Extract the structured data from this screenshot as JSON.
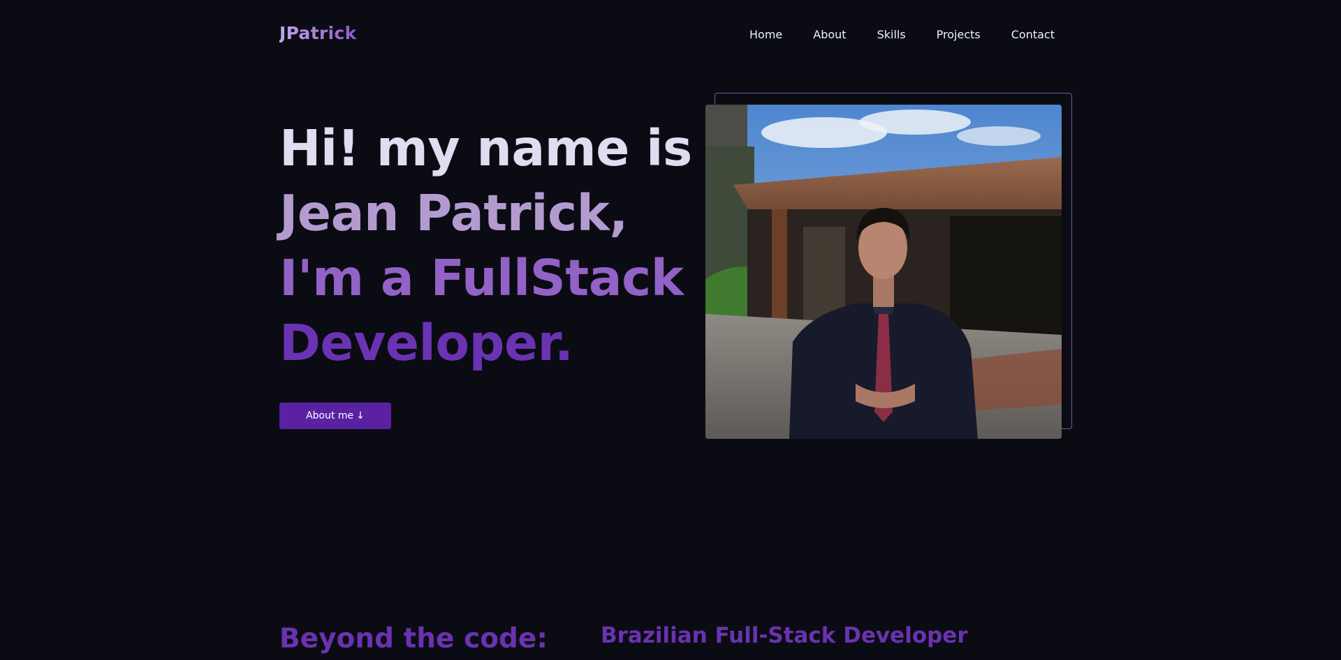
{
  "navbar": {
    "logo": "JPatrick",
    "links": [
      "Home",
      "About",
      "Skills",
      "Projects",
      "Contact"
    ]
  },
  "hero": {
    "lines": [
      "Hi! my name is",
      "Jean Patrick,",
      "I'm a FullStack",
      "Developer."
    ],
    "button_label": "About me",
    "button_icon": "arrow-down-icon",
    "button_icon_glyph": "↓",
    "photo_alt": "Jean Patrick portrait"
  },
  "about": {
    "heading": "Beyond the code:",
    "subtitle": "Brazilian Full-Stack Developer"
  },
  "colors": {
    "background": "#0b0c13",
    "accent": "#5b21a3",
    "frame": "#6c5ca7"
  }
}
